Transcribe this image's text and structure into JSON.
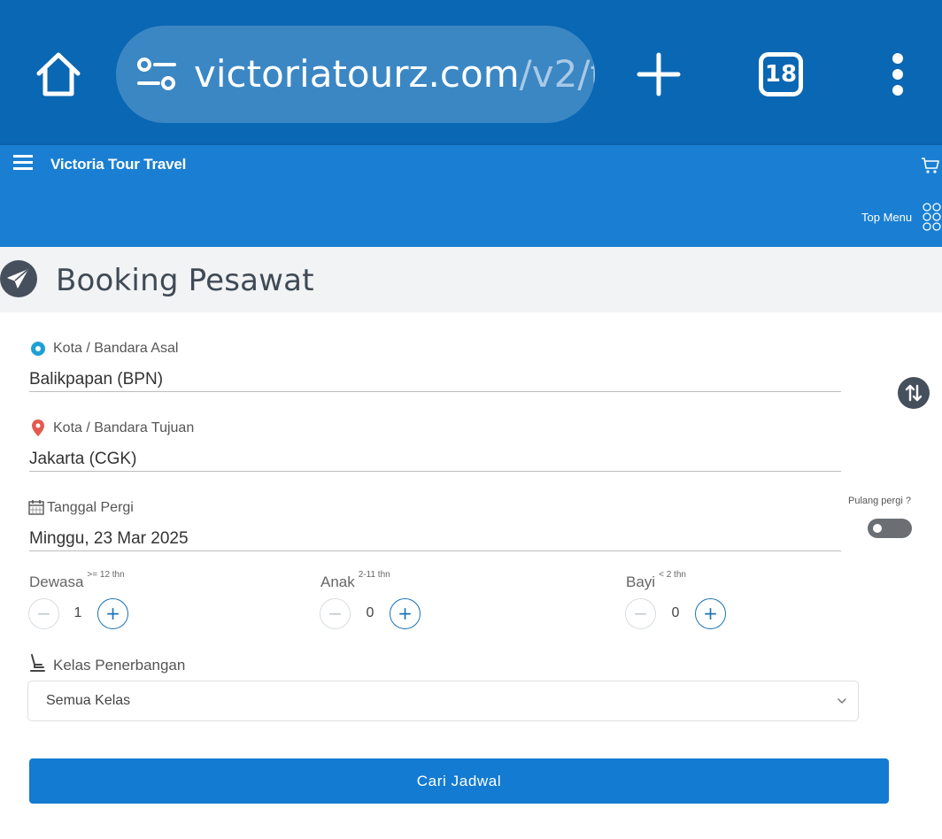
{
  "browser": {
    "url_domain": "victoriatourz.com",
    "url_path": "/v2/t",
    "tab_count": "18"
  },
  "header": {
    "site_title": "Victoria Tour Travel",
    "top_menu_label": "Top Menu"
  },
  "page": {
    "title": "Booking Pesawat"
  },
  "form": {
    "origin": {
      "label": "Kota / Bandara Asal",
      "value": "Balikpapan (BPN)"
    },
    "destination": {
      "label": "Kota / Bandara Tujuan",
      "value": "Jakarta (CGK)"
    },
    "departure": {
      "label": "Tanggal Pergi",
      "value": "Minggu, 23 Mar 2025"
    },
    "round_trip": {
      "label": "Pulang pergi ?",
      "enabled": false
    },
    "passengers": [
      {
        "label": "Dewasa",
        "age_note": ">= 12 thn",
        "count": "1"
      },
      {
        "label": "Anak",
        "age_note": "2-11 thn",
        "count": "0"
      },
      {
        "label": "Bayi",
        "age_note": "< 2 thn",
        "count": "0"
      }
    ],
    "stepper": {
      "minus": "−",
      "plus": "+"
    },
    "cabin_class": {
      "label": "Kelas Penerbangan",
      "selected": "Semua Kelas"
    },
    "submit_label": "Cari Jadwal"
  },
  "colors": {
    "browser_bar": "#0a67b3",
    "site_header": "#1a7fd3",
    "primary_button": "#137bd2",
    "origin_icon": "#1ea0d6",
    "destination_icon": "#e55a4e"
  },
  "icons": {
    "home": "home-icon",
    "site_settings": "tune-icon",
    "new_tab": "plus-icon",
    "tabs": "tab-switcher-icon",
    "overflow": "more-vert-icon",
    "hamburger": "menu-icon",
    "cart": "cart-icon",
    "top_menu": "grid-icon",
    "plane": "paper-plane-icon",
    "swap": "swap-vertical-icon",
    "calendar": "calendar-icon",
    "seat": "seat-icon"
  }
}
